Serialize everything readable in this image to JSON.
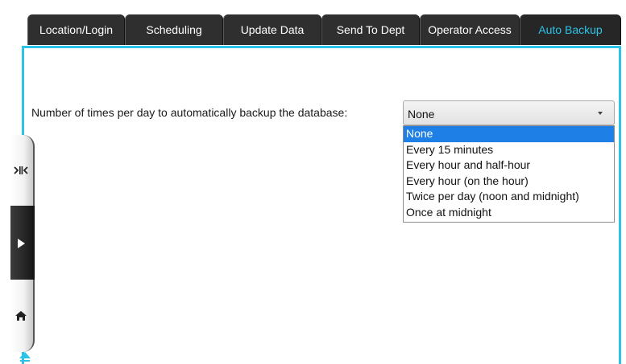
{
  "tabs": [
    {
      "label": "Location/Login",
      "active": false
    },
    {
      "label": "Scheduling",
      "active": false
    },
    {
      "label": "Update Data",
      "active": false
    },
    {
      "label": "Send To Dept",
      "active": false
    },
    {
      "label": "Operator Access",
      "active": false
    },
    {
      "label": "Auto Backup",
      "active": true
    }
  ],
  "backup": {
    "label": "Number of times per day to automatically backup the database:",
    "selected_value": "None",
    "options": [
      "None",
      "Every 15 minutes",
      "Every hour and half-hour",
      "Every hour (on the hour)",
      "Twice per day (noon and midnight)",
      "Once at midnight"
    ]
  },
  "side_nav": {
    "icons": [
      "collapse-arrows-icon",
      "play-icon",
      "home-icon"
    ]
  },
  "colors": {
    "accent": "#2bc3e8",
    "tab_background": "#2f2f2f",
    "selection": "#1e7fe6"
  }
}
